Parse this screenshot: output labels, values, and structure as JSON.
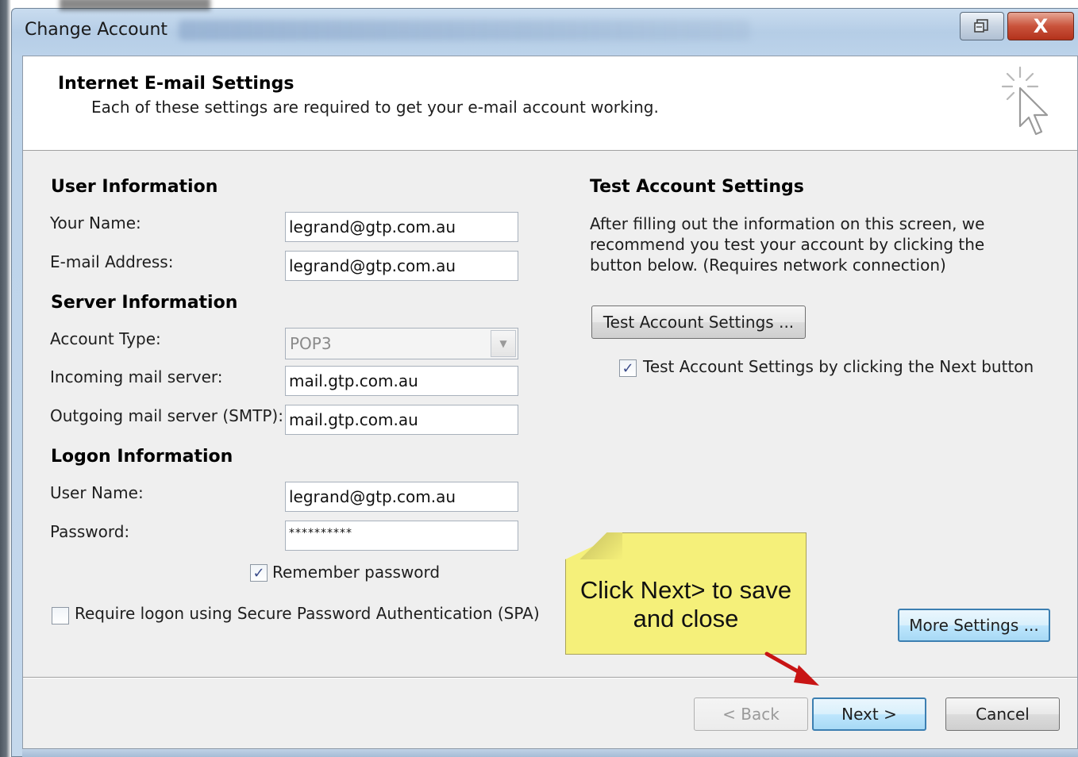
{
  "window": {
    "title": "Change Account",
    "help_icon": "restore-icon",
    "close_glyph": "X"
  },
  "header": {
    "title": "Internet E-mail Settings",
    "subtitle": "Each of these settings are required to get your e-mail account working.",
    "icon": "cursor-click-icon"
  },
  "user_info": {
    "heading": "User Information",
    "name_label": "Your Name:",
    "name_value": "legrand@gtp.com.au",
    "email_label": "E-mail Address:",
    "email_value": "legrand@gtp.com.au"
  },
  "server_info": {
    "heading": "Server Information",
    "account_type_label": "Account Type:",
    "account_type_value": "POP3",
    "incoming_label": "Incoming mail server:",
    "incoming_value": "mail.gtp.com.au",
    "outgoing_label": "Outgoing mail server (SMTP):",
    "outgoing_value": "mail.gtp.com.au"
  },
  "logon_info": {
    "heading": "Logon Information",
    "username_label": "User Name:",
    "username_value": "legrand@gtp.com.au",
    "password_label": "Password:",
    "password_value": "**********",
    "remember_label": "Remember password",
    "remember_checked": true,
    "spa_label": "Require logon using Secure Password Authentication (SPA)",
    "spa_checked": false
  },
  "test_settings": {
    "heading": "Test Account Settings",
    "description": "After filling out the information on this screen, we recommend you test your account by clicking the button below. (Requires network connection)",
    "button_label": "Test Account Settings ...",
    "next_test_label": "Test Account Settings by clicking the Next button",
    "next_test_checked": true
  },
  "callout": {
    "text_line1": "Click Next> to save",
    "text_line2": "and close",
    "color": "#f5f07a",
    "arrow_color": "#c81414"
  },
  "buttons": {
    "more_settings": "More Settings ...",
    "back": "< Back",
    "next": "Next >",
    "cancel": "Cancel"
  }
}
